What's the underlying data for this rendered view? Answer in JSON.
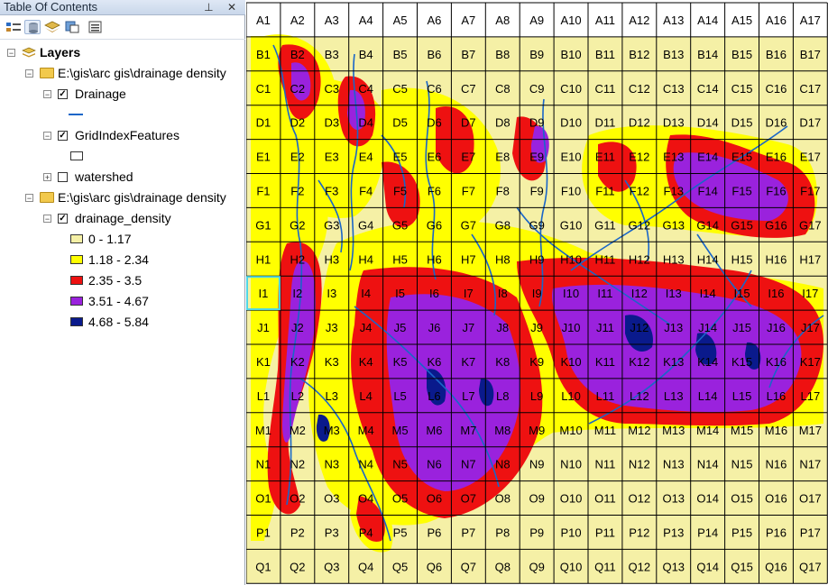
{
  "toc": {
    "title": "Table Of Contents",
    "window_buttons": "⊥ ✕",
    "toolbar_icons": [
      "list-by-drawing-order-icon",
      "list-by-source-icon",
      "list-by-visibility-icon",
      "list-by-selection-icon",
      "options-icon"
    ],
    "layers_root": "Layers",
    "groups": [
      {
        "path": "E:\\gis\\arc gis\\drainage density",
        "layers": [
          {
            "name": "Drainage",
            "checked": true,
            "symbol": "line",
            "color": "#1a66c8"
          },
          {
            "name": "GridIndexFeatures",
            "checked": true,
            "symbol": "hollow-rect"
          },
          {
            "name": "watershed",
            "checked": false,
            "collapsed": true
          }
        ]
      },
      {
        "path": "E:\\gis\\arc gis\\drainage density",
        "layers": [
          {
            "name": "drainage_density",
            "checked": true,
            "legend": [
              {
                "label": "0 - 1.17",
                "color": "#f5f0a6"
              },
              {
                "label": "1.18 - 2.34",
                "color": "#ffff00"
              },
              {
                "label": "2.35 - 3.5",
                "color": "#ee1111"
              },
              {
                "label": "3.51 - 4.67",
                "color": "#9a22dd"
              },
              {
                "label": "4.68 - 5.84",
                "color": "#0a1a8c"
              }
            ]
          }
        ]
      }
    ]
  },
  "map": {
    "grid_rows": [
      "A",
      "B",
      "C",
      "D",
      "E",
      "F",
      "G",
      "H",
      "I",
      "J",
      "K",
      "L",
      "M",
      "N",
      "O",
      "P",
      "Q"
    ],
    "grid_cols": 17,
    "selected_cell": "I1",
    "colors": {
      "cell_fill": "#f5f0a6",
      "grid_line": "#000000",
      "stream": "#1a66c8",
      "selection": "#4fd6e6"
    }
  }
}
